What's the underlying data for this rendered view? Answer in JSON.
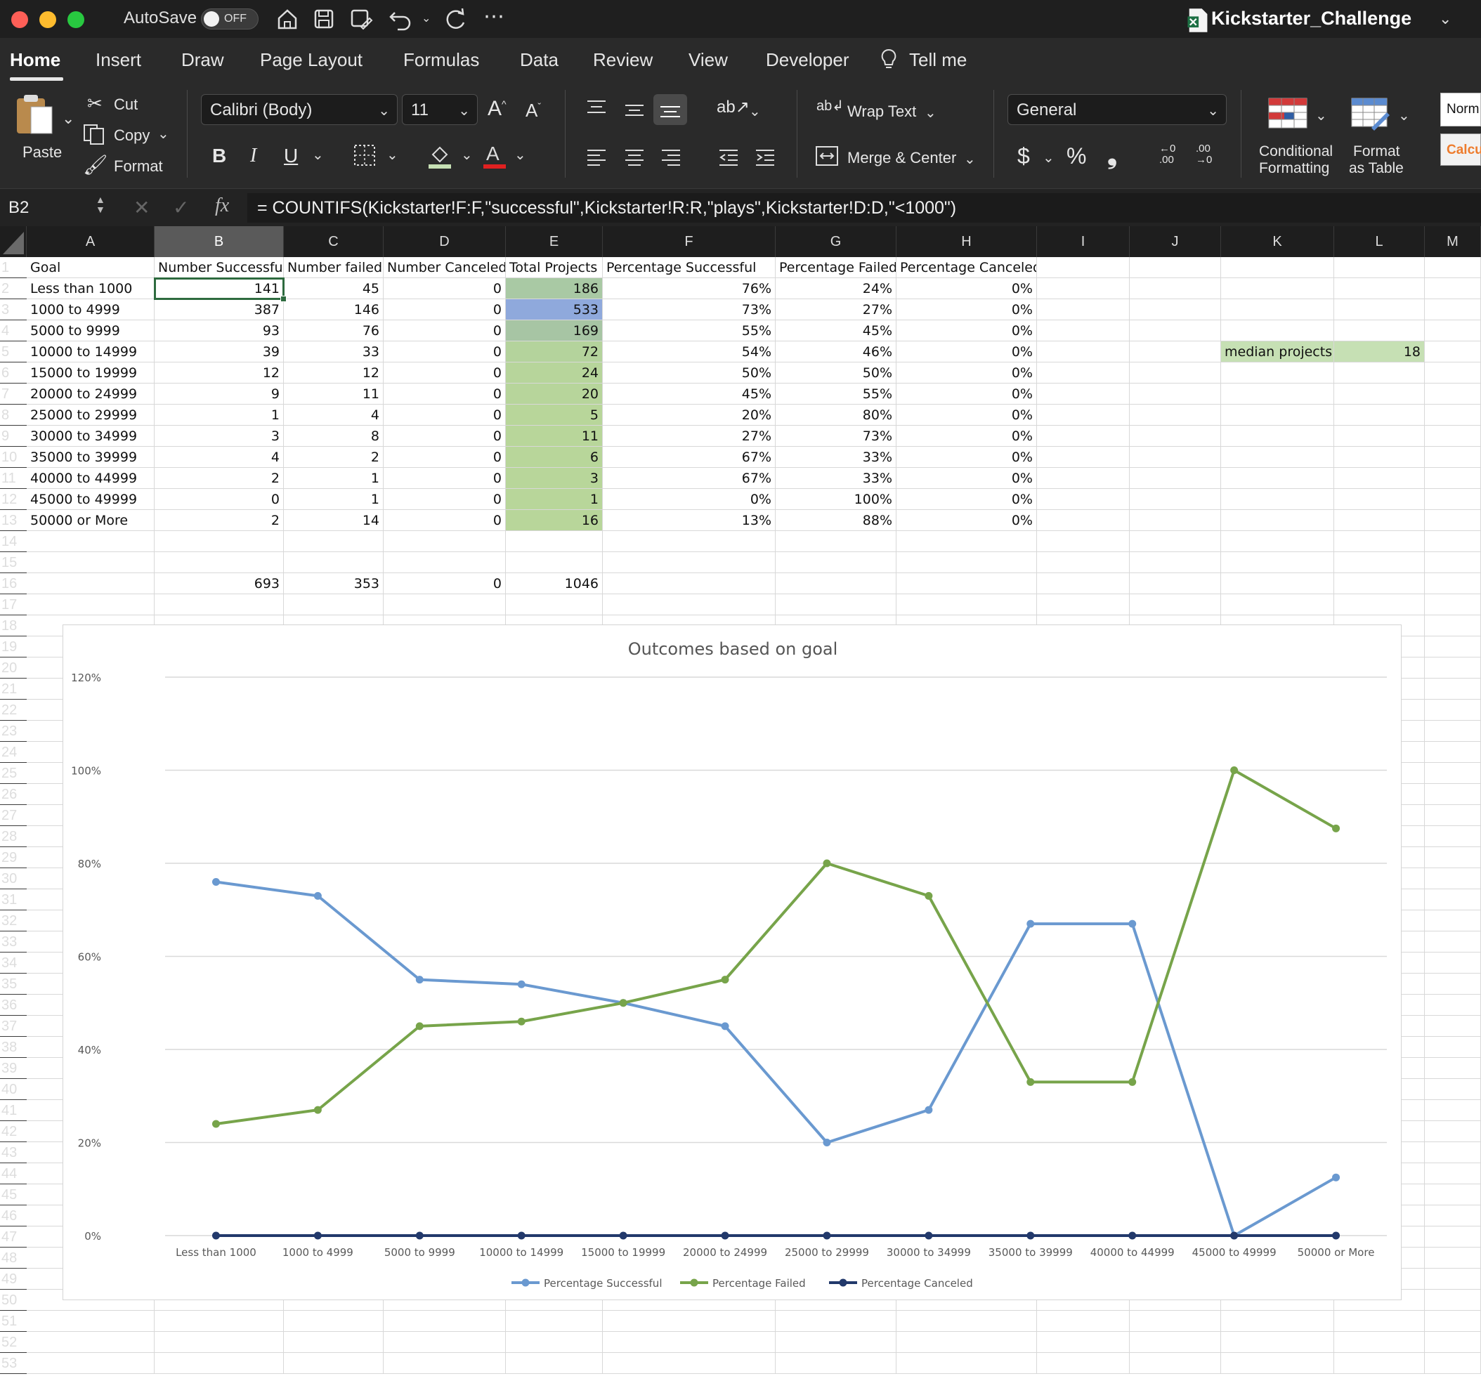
{
  "window": {
    "autosave_label": "AutoSave",
    "autosave_state": "OFF",
    "doc_title": "Kickstarter_Challenge"
  },
  "menu_tabs": [
    "Home",
    "Insert",
    "Draw",
    "Page Layout",
    "Formulas",
    "Data",
    "Review",
    "View",
    "Developer",
    "Tell me"
  ],
  "ribbon": {
    "paste": "Paste",
    "cut": "Cut",
    "copy": "Copy",
    "format": "Format",
    "font_name": "Calibri (Body)",
    "font_size": "11",
    "bold": "B",
    "italic": "I",
    "underline": "U",
    "wrap_text": "Wrap Text",
    "merge_center": "Merge & Center",
    "number_format": "General",
    "currency": "$",
    "percent": "%",
    "comma": "❟",
    "conditional_formatting_1": "Conditional",
    "conditional_formatting_2": "Formatting",
    "format_table_1": "Format",
    "format_table_2": "as Table",
    "style_normal": "Norm",
    "style_calc": "Calcu"
  },
  "formula_bar": {
    "cell_ref": "B2",
    "fx": "fx",
    "formula": "= COUNTIFS(Kickstarter!F:F,\"successful\",Kickstarter!R:R,\"plays\",Kickstarter!D:D,\"<1000\")"
  },
  "columns": [
    "A",
    "B",
    "C",
    "D",
    "E",
    "F",
    "G",
    "H",
    "I",
    "J",
    "K",
    "L",
    "M"
  ],
  "rows": [
    "1",
    "2",
    "3",
    "4",
    "5",
    "6",
    "7",
    "8",
    "9",
    "10",
    "11",
    "12",
    "13",
    "14",
    "15",
    "16",
    "17",
    "18",
    "19",
    "20",
    "21",
    "22",
    "23",
    "24",
    "25",
    "26",
    "27",
    "28",
    "29",
    "30",
    "31",
    "32",
    "33",
    "34",
    "35",
    "36",
    "37",
    "38",
    "39",
    "40",
    "41",
    "42",
    "43",
    "44",
    "45",
    "46",
    "47",
    "48",
    "49",
    "50",
    "51",
    "52",
    "53"
  ],
  "table": {
    "headers": [
      "Goal",
      "Number Successful",
      "Number failed",
      "Number Canceled",
      "Total Projects",
      "Percentage Successful",
      "Percentage Failed",
      "Percentage Canceled"
    ],
    "rows": [
      [
        "Less than 1000",
        "141",
        "45",
        "0",
        "186",
        "76%",
        "24%",
        "0%"
      ],
      [
        "1000 to 4999",
        "387",
        "146",
        "0",
        "533",
        "73%",
        "27%",
        "0%"
      ],
      [
        "5000 to 9999",
        "93",
        "76",
        "0",
        "169",
        "55%",
        "45%",
        "0%"
      ],
      [
        "10000 to 14999",
        "39",
        "33",
        "0",
        "72",
        "54%",
        "46%",
        "0%"
      ],
      [
        "15000 to 19999",
        "12",
        "12",
        "0",
        "24",
        "50%",
        "50%",
        "0%"
      ],
      [
        "20000 to 24999",
        "9",
        "11",
        "0",
        "20",
        "45%",
        "55%",
        "0%"
      ],
      [
        "25000 to 29999",
        "1",
        "4",
        "0",
        "5",
        "20%",
        "80%",
        "0%"
      ],
      [
        "30000 to 34999",
        "3",
        "8",
        "0",
        "11",
        "27%",
        "73%",
        "0%"
      ],
      [
        "35000 to 39999",
        "4",
        "2",
        "0",
        "6",
        "67%",
        "33%",
        "0%"
      ],
      [
        "40000 to 44999",
        "2",
        "1",
        "0",
        "3",
        "67%",
        "33%",
        "0%"
      ],
      [
        "45000 to 49999",
        "0",
        "1",
        "0",
        "1",
        "0%",
        "100%",
        "0%"
      ],
      [
        "50000 or More",
        "2",
        "14",
        "0",
        "16",
        "13%",
        "88%",
        "0%"
      ]
    ],
    "totals": [
      "693",
      "353",
      "0",
      "1046"
    ],
    "total_heat_colors": [
      "#a9c9a4",
      "#8fa9dc",
      "#a7c5a4",
      "#b4d39c",
      "#b7d59b",
      "#b7d59b",
      "#b8d69a",
      "#b8d69a",
      "#b8d69a",
      "#b8d69a",
      "#b8d69a",
      "#b8d69a"
    ]
  },
  "median": {
    "label": "median projects",
    "value": "18",
    "color": "#c6e0b4"
  },
  "colors": {
    "successful": "#6a99d0",
    "failed": "#77a44a",
    "canceled": "#22396b",
    "selection": "#2e6b3f"
  },
  "chart_data": {
    "type": "line",
    "title": "Outcomes based on goal",
    "categories": [
      "Less than 1000",
      "1000 to 4999",
      "5000 to 9999",
      "10000 to 14999",
      "15000 to 19999",
      "20000 to 24999",
      "25000 to 29999",
      "30000 to 34999",
      "35000 to 39999",
      "40000 to 44999",
      "45000 to 49999",
      "50000 or More"
    ],
    "series": [
      {
        "name": "Percentage Successful",
        "color": "#6a99d0",
        "values": [
          0.76,
          0.73,
          0.55,
          0.54,
          0.5,
          0.45,
          0.2,
          0.27,
          0.67,
          0.67,
          0.0,
          0.125
        ]
      },
      {
        "name": "Percentage Failed",
        "color": "#77a44a",
        "values": [
          0.24,
          0.27,
          0.45,
          0.46,
          0.5,
          0.55,
          0.8,
          0.73,
          0.33,
          0.33,
          1.0,
          0.875
        ]
      },
      {
        "name": "Percentage Canceled",
        "color": "#22396b",
        "values": [
          0,
          0,
          0,
          0,
          0,
          0,
          0,
          0,
          0,
          0,
          0,
          0
        ]
      }
    ],
    "ylim": [
      0,
      1.2
    ],
    "yticks": [
      "0%",
      "20%",
      "40%",
      "60%",
      "80%",
      "100%",
      "120%"
    ],
    "grid": true,
    "legend": "bottom"
  }
}
